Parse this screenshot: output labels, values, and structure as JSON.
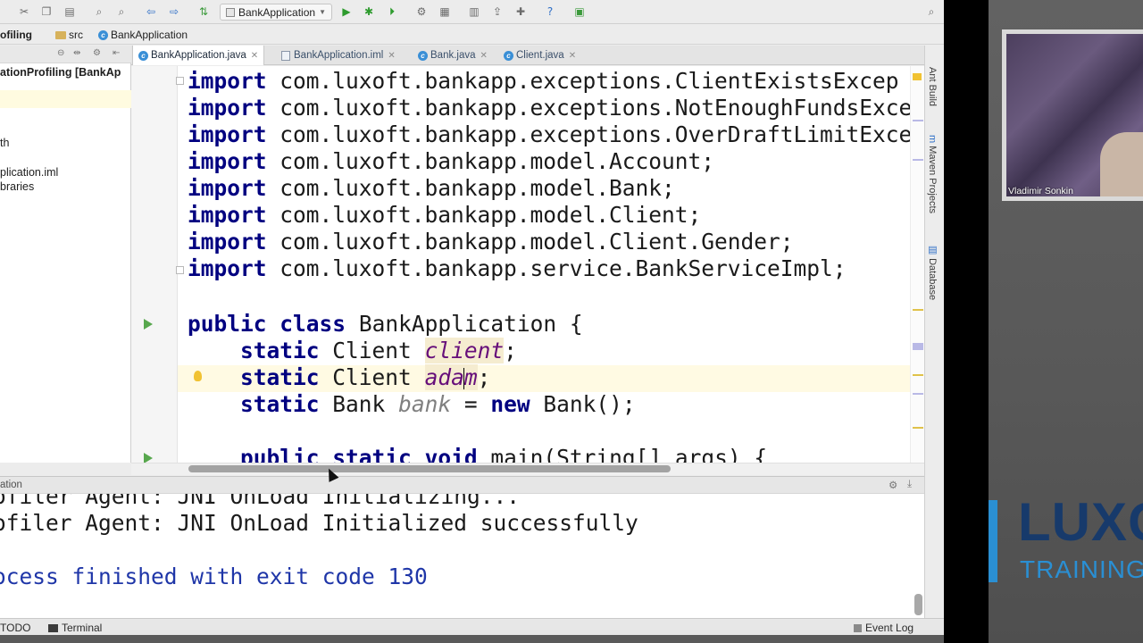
{
  "toolbar": {
    "run_config": "BankApplication",
    "icons": [
      "cut-icon",
      "copy-icon",
      "paste-icon",
      "find-icon",
      "replace-icon",
      "back-icon",
      "forward-icon",
      "build-icon",
      "run-icon",
      "debug-icon",
      "coverage-icon",
      "settings-icon",
      "structure-icon",
      "vcs-icon",
      "help-icon",
      "search-icon"
    ]
  },
  "breadcrumb": {
    "project": "ofiling",
    "src": "src",
    "file": "BankApplication"
  },
  "project_panel": {
    "title": "ationProfiling [BankAp",
    "items": [
      "th",
      "plication.iml",
      "braries"
    ]
  },
  "tabs": [
    {
      "label": "BankApplication.java",
      "active": true
    },
    {
      "label": "BankApplication.iml",
      "active": false
    },
    {
      "label": "Bank.java",
      "active": false
    },
    {
      "label": "Client.java",
      "active": false
    }
  ],
  "editor": {
    "imports": [
      "com.luxoft.bankapp.exceptions.ClientExistsExcep",
      "com.luxoft.bankapp.exceptions.NotEnoughFundsExce",
      "com.luxoft.bankapp.exceptions.OverDraftLimitExce",
      "com.luxoft.bankapp.model.Account;",
      "com.luxoft.bankapp.model.Bank;",
      "com.luxoft.bankapp.model.Client;",
      "com.luxoft.bankapp.model.Client.Gender;",
      "com.luxoft.bankapp.service.BankServiceImpl;"
    ],
    "kw_import": "import",
    "kw_public": "public",
    "kw_class": "class",
    "kw_static": "static",
    "kw_new": "new",
    "kw_void": "void",
    "class_name": "BankApplication {",
    "type_client": "Client",
    "type_bank": "Bank",
    "field_client": "client",
    "field_adam_a": "ada",
    "field_adam_b": "m",
    "field_bank": "bank",
    "semicolon": ";",
    "bank_init": " = ",
    "bank_ctor": "Bank();",
    "main_sig": "main(String[] args) {"
  },
  "run_panel": {
    "title": "ation",
    "lines": [
      "ofiler Agent: JNI OnLoad Initializing...",
      "ofiler Agent: JNI OnLoad Initialized successfully",
      "ocess finished with exit code 130"
    ]
  },
  "side_tabs": [
    "Ant Build",
    "Maven Projects",
    "Database"
  ],
  "statusbar": {
    "todo": "TODO",
    "terminal": "Terminal",
    "event_log": "Event Log"
  },
  "webcam": {
    "name": "Vladimir Sonkin"
  },
  "branding": {
    "logo": "LUXO",
    "sub": "TRAINING",
    "accent": "#2a8fd3",
    "dark": "#173a6b"
  }
}
